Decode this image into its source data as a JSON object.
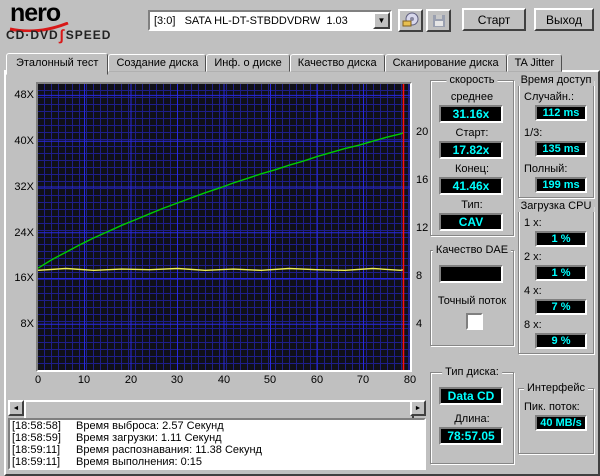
{
  "window": {
    "logo_nero": "nero",
    "logo_cddvd": "CD·DVD",
    "logo_integral": "∫",
    "logo_speed": "SPEED",
    "drive": "[3:0]   SATA HL-DT-STBDDVDRW  1.03",
    "start_button": "Старт",
    "exit_button": "Выход",
    "combo_arrow": "▼",
    "scroll_left": "◄",
    "scroll_right": "►"
  },
  "tabs": [
    {
      "label": "Эталонный тест",
      "active": true
    },
    {
      "label": "Создание диска",
      "active": false
    },
    {
      "label": "Инф. о диске",
      "active": false
    },
    {
      "label": "Качество диска",
      "active": false
    },
    {
      "label": "Сканирование диска",
      "active": false
    },
    {
      "label": "TA Jitter",
      "active": false
    }
  ],
  "chart_data": {
    "type": "line",
    "x_range": [
      0,
      80
    ],
    "x_ticks": [
      0,
      10,
      20,
      30,
      40,
      50,
      60,
      70,
      80
    ],
    "x_tick_labels": [
      "0",
      "10",
      "20",
      "30",
      "40",
      "50",
      "60",
      "70",
      "80"
    ],
    "y_left_range": [
      0,
      50
    ],
    "y_left_tick_values": [
      48,
      40,
      32,
      24,
      16,
      8
    ],
    "y_left_tick_labels": [
      "48X",
      "40X",
      "32X",
      "24X",
      "16X",
      "8X"
    ],
    "y_right_range": [
      0,
      23.8
    ],
    "y_right_tick_values": [
      20,
      16,
      12,
      8,
      4
    ],
    "y_right_tick_labels": [
      "20",
      "16",
      "12",
      "8",
      "4"
    ],
    "background": "#101018",
    "grid_minor_color": "#1e1e8a",
    "grid_major_color": "#2828e0",
    "end_marker_x": 78.6,
    "end_marker_color": "#ff1010",
    "series": [
      {
        "name": "read-speed",
        "axis": "left",
        "color": "#00cc00",
        "x": [
          0,
          3,
          6,
          9,
          12,
          15,
          18,
          21,
          24,
          27,
          30,
          33,
          36,
          39,
          42,
          45,
          48,
          51,
          54,
          57,
          60,
          63,
          66,
          69,
          72,
          75,
          78,
          78.6
        ],
        "y": [
          17.8,
          19.3,
          20.6,
          21.9,
          23.1,
          24.2,
          25.3,
          26.3,
          27.3,
          28.3,
          29.2,
          30.1,
          31.0,
          31.8,
          32.7,
          33.5,
          34.3,
          35.0,
          35.8,
          36.5,
          37.3,
          38.0,
          38.7,
          39.3,
          40.0,
          40.7,
          41.3,
          41.5
        ]
      },
      {
        "name": "rotation-speed",
        "axis": "right",
        "color": "#f0f050",
        "x": [
          0,
          6,
          12,
          18,
          24,
          30,
          36,
          42,
          48,
          54,
          60,
          66,
          72,
          78,
          78.6
        ],
        "y": [
          8.3,
          8.45,
          8.3,
          8.4,
          8.35,
          8.45,
          8.3,
          8.4,
          8.3,
          8.45,
          8.35,
          8.3,
          8.45,
          8.3,
          8.35
        ]
      }
    ]
  },
  "speed_panel": {
    "title": "скорость",
    "average_label": "среднее",
    "average": "31.16x",
    "start_label": "Старт:",
    "start": "17.82x",
    "end_label": "Конец:",
    "end": "41.46x",
    "type_label": "Тип:",
    "type": "CAV"
  },
  "dae_panel": {
    "title": "Качество DAE",
    "value": "",
    "accurate_stream_label": "Точный поток",
    "accurate_stream_checked": false
  },
  "disc_panel": {
    "title": "Тип диска:",
    "disc_type": "Data CD",
    "length_label": "Длина:",
    "length": "78:57.05"
  },
  "access_panel": {
    "title": "Время доступ",
    "items": [
      {
        "label": "Случайн.:",
        "value": "112 ms"
      },
      {
        "label": "1/3:",
        "value": "135 ms"
      },
      {
        "label": "Полный:",
        "value": "199 ms"
      }
    ]
  },
  "cpu_panel": {
    "title": "Загрузка CPU",
    "items": [
      {
        "label": "1 x:",
        "value": "1 %"
      },
      {
        "label": "2 x:",
        "value": "1 %"
      },
      {
        "label": "4 x:",
        "value": "7 %"
      },
      {
        "label": "8 x:",
        "value": "9 %"
      }
    ]
  },
  "interface_panel": {
    "title": "Интерфейс",
    "burst_label": "Пик. поток:",
    "burst_value": "40 MB/s"
  },
  "log": [
    {
      "time": "[18:58:58]",
      "text": "Время выброса: 2.57 Секунд"
    },
    {
      "time": "[18:58:59]",
      "text": "Время загрузки: 1.11 Секунд"
    },
    {
      "time": "[18:59:11]",
      "text": "Время распознавания: 11.38 Секунд"
    },
    {
      "time": "[18:59:11]",
      "text": "Время выполнения: 0:15"
    }
  ]
}
